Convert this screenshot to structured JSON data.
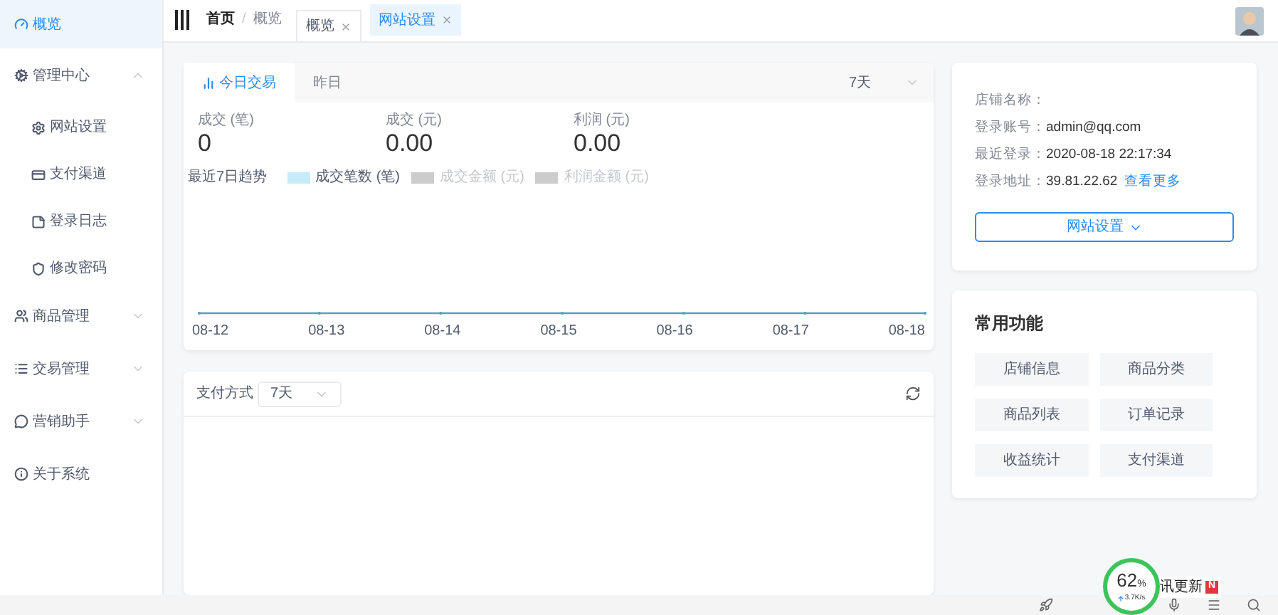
{
  "sidebar": {
    "items": [
      {
        "label": "概览",
        "selected": true
      },
      {
        "label": "管理中心",
        "selected": false,
        "expanded": true,
        "children": [
          {
            "label": "网站设置",
            "selected": false
          },
          {
            "label": "支付渠道",
            "selected": false
          },
          {
            "label": "登录日志",
            "selected": false
          },
          {
            "label": "修改密码",
            "selected": false
          }
        ]
      },
      {
        "label": "商品管理",
        "selected": false,
        "expanded": false
      },
      {
        "label": "交易管理",
        "selected": false,
        "expanded": false
      },
      {
        "label": "营销助手",
        "selected": false,
        "expanded": false
      },
      {
        "label": "关于系统",
        "selected": false
      }
    ]
  },
  "header": {
    "breadcrumb": [
      "首页",
      "概览"
    ],
    "separator": "/",
    "tabs": [
      {
        "label": "概览",
        "selected": true
      },
      {
        "label": "网站设置",
        "selected": false
      }
    ]
  },
  "overview": {
    "tabs": [
      {
        "label": "今日交易",
        "selected": true
      },
      {
        "label": "昨日",
        "selected": false
      }
    ],
    "range": "7天",
    "stats": [
      {
        "label": "成交 (笔)",
        "value": "0"
      },
      {
        "label": "成交 (元)",
        "value": "0.00"
      },
      {
        "label": "利润 (元)",
        "value": "0.00"
      }
    ],
    "trend": {
      "title": "最近7日趋势",
      "legend": [
        {
          "label": "成交笔数 (笔)",
          "on": true
        },
        {
          "label": "成交金额 (元)",
          "on": false
        },
        {
          "label": "利润金额 (元)",
          "on": false
        }
      ],
      "x_labels": [
        "08-12",
        "08-13",
        "08-14",
        "08-15",
        "08-16",
        "08-17",
        "08-18"
      ]
    }
  },
  "payment": {
    "label": "支付方式",
    "range": "7天"
  },
  "store_info": {
    "rows": [
      {
        "label": "店铺名称："
      },
      {
        "label": "登录账号：",
        "value": "admin@qq.com"
      },
      {
        "label": "最近登录：",
        "value": "2020-08-18 22:17:34"
      },
      {
        "label": "登录地址：",
        "value": "39.81.22.62",
        "link": "查看更多"
      }
    ],
    "button": "网站设置"
  },
  "quick": {
    "title": "常用功能",
    "buttons": [
      "店铺信息",
      "商品分类",
      "商品列表",
      "订单记录",
      "收益统计",
      "支付渠道"
    ]
  },
  "widget": {
    "percent": "62",
    "unit": "%",
    "speed": "3.7K/s",
    "news": "讯更新",
    "badge": "N"
  }
}
